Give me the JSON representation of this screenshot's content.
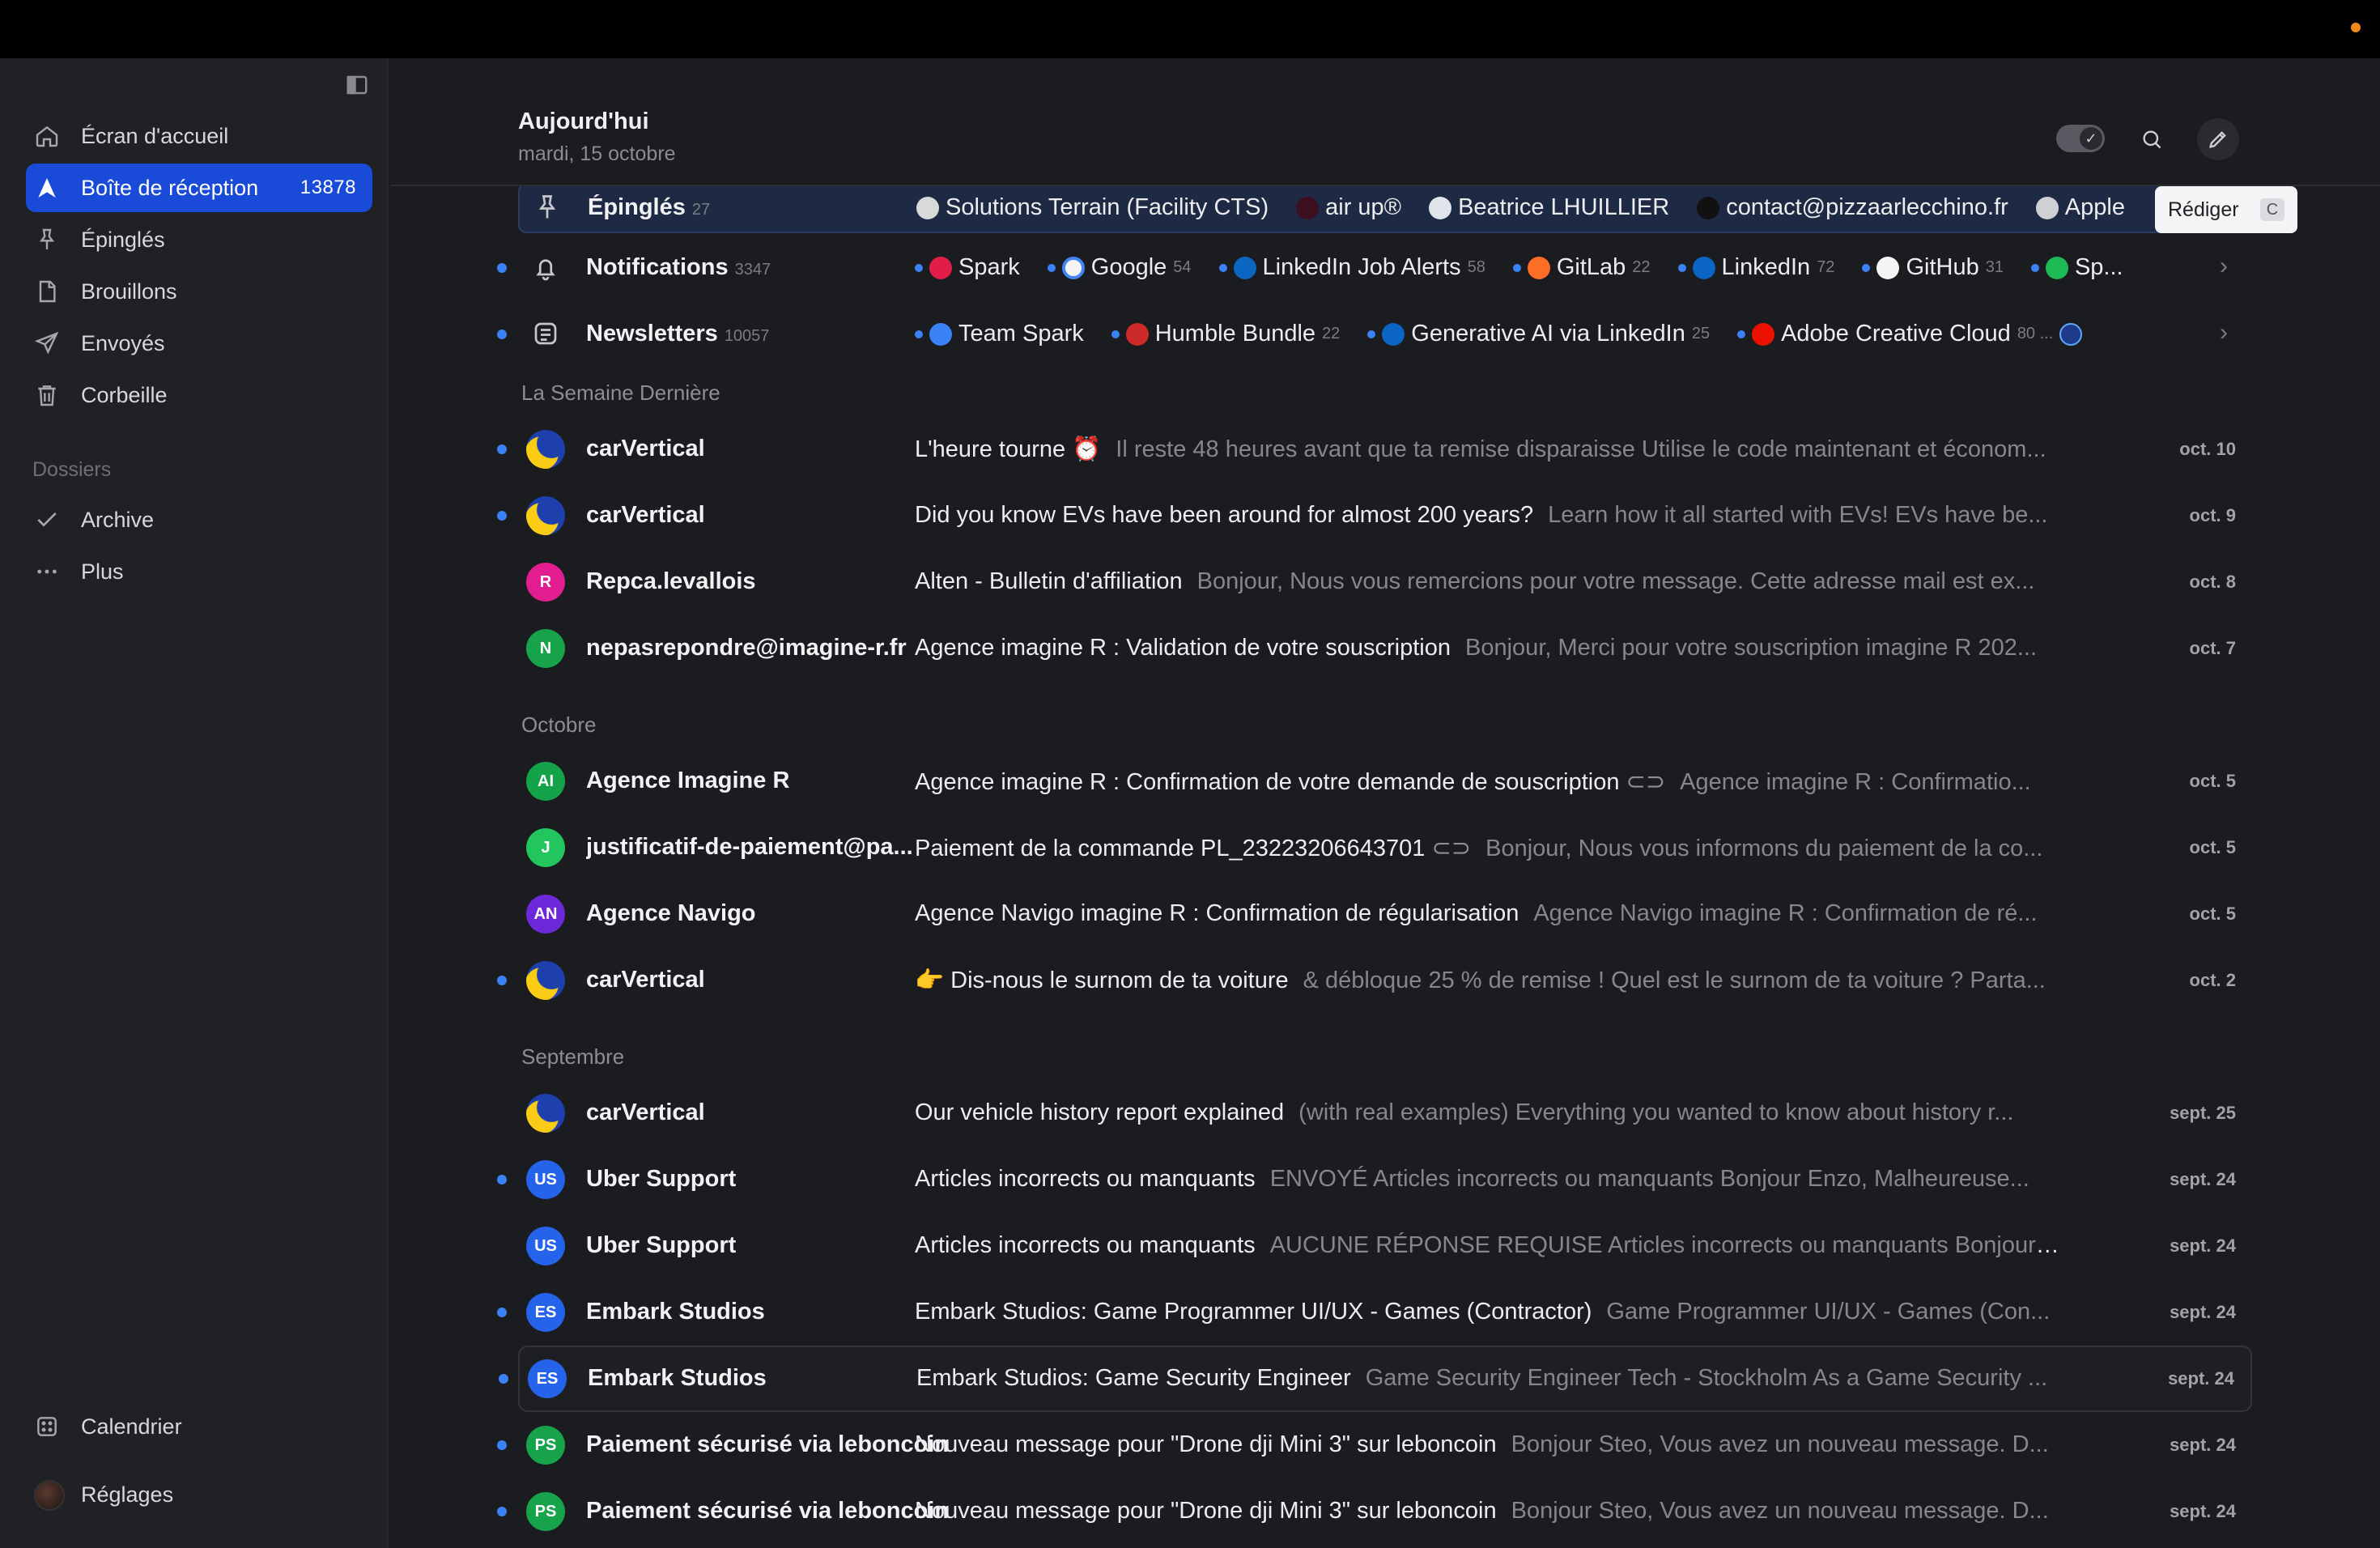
{
  "sidebar": {
    "nav": [
      {
        "label": "Écran d'accueil",
        "icon": "home-icon"
      },
      {
        "label": "Boîte de réception",
        "icon": "inbox-icon",
        "count": "13878"
      },
      {
        "label": "Épinglés",
        "icon": "pin-icon"
      },
      {
        "label": "Brouillons",
        "icon": "draft-icon"
      },
      {
        "label": "Envoyés",
        "icon": "send-icon"
      },
      {
        "label": "Corbeille",
        "icon": "trash-icon"
      }
    ],
    "folders_label": "Dossiers",
    "folders": [
      {
        "label": "Archive",
        "icon": "check-icon"
      },
      {
        "label": "Plus",
        "icon": "more-icon"
      }
    ],
    "bottom": [
      {
        "label": "Calendrier",
        "icon": "calendar-icon"
      },
      {
        "label": "Réglages",
        "icon": "avatar"
      }
    ]
  },
  "header": {
    "title": "Aujourd'hui",
    "date": "mardi, 15 octobre",
    "tooltip": "Rédiger",
    "tooltip_key": "C"
  },
  "categories": [
    {
      "name": "Épinglés",
      "count": "27",
      "icon": "pin-icon",
      "senders": [
        {
          "name": "Solutions Terrain (Facility CTS)",
          "count": ""
        },
        {
          "name": "air up®",
          "count": ""
        },
        {
          "name": "Beatrice LHUILLIER",
          "count": ""
        },
        {
          "name": "contact@pizzaarlecchino.fr",
          "count": ""
        },
        {
          "name": "Apple",
          "count": ""
        }
      ]
    },
    {
      "name": "Notifications",
      "count": "3347",
      "icon": "bell-icon",
      "senders": [
        {
          "name": "Spark",
          "count": ""
        },
        {
          "name": "Google",
          "count": "54"
        },
        {
          "name": "LinkedIn Job Alerts",
          "count": "58"
        },
        {
          "name": "GitLab",
          "count": "22"
        },
        {
          "name": "LinkedIn",
          "count": "72"
        },
        {
          "name": "GitHub",
          "count": "31"
        },
        {
          "name": "Sp...",
          "count": ""
        }
      ]
    },
    {
      "name": "Newsletters",
      "count": "10057",
      "icon": "newspaper-icon",
      "senders": [
        {
          "name": "Team Spark",
          "count": ""
        },
        {
          "name": "Humble Bundle",
          "count": "22"
        },
        {
          "name": "Generative AI via LinkedIn",
          "count": "25"
        },
        {
          "name": "Adobe Creative Cloud",
          "count": "80 ..."
        }
      ]
    }
  ],
  "groups": [
    {
      "label": "La Semaine Dernière",
      "emails": [
        {
          "sender": "carVertical",
          "subject": "L'heure tourne ⏰",
          "preview": "Il reste 48 heures avant que ta remise disparaisse Utilise le code maintenant et économ...",
          "date": "oct. 10",
          "unread": true,
          "avatar": "carvertical"
        },
        {
          "sender": "carVertical",
          "subject": "Did you know EVs have been around for almost 200 years?",
          "preview": "Learn how it all started with EVs! EVs have be...",
          "date": "oct. 9",
          "unread": true,
          "avatar": "carvertical"
        },
        {
          "sender": "Repca.levallois",
          "subject": "Alten - Bulletin d'affiliation",
          "preview": "Bonjour, Nous vous remercions pour votre message. Cette adresse mail est ex...",
          "date": "oct. 8",
          "unread": false,
          "avatar": "R"
        },
        {
          "sender": "nepasrepondre@imagine-r.fr",
          "subject": "Agence imagine R : Validation de votre souscription",
          "preview": "Bonjour, Merci pour votre souscription imagine R 202...",
          "date": "oct. 7",
          "unread": false,
          "avatar": "N"
        }
      ]
    },
    {
      "label": "Octobre",
      "emails": [
        {
          "sender": "Agence Imagine R",
          "subject": "Agence imagine R : Confirmation de votre demande de souscription",
          "preview": "Agence imagine R : Confirmatio...",
          "date": "oct. 5",
          "unread": false,
          "avatar": "AI",
          "attachment": true
        },
        {
          "sender": "justificatif-de-paiement@pa...",
          "subject": "Paiement de la commande PL_23223206643701",
          "preview": "Bonjour, Nous vous informons du paiement de la co...",
          "date": "oct. 5",
          "unread": false,
          "avatar": "J",
          "attachment": true
        },
        {
          "sender": "Agence Navigo",
          "subject": "Agence Navigo imagine R : Confirmation de régularisation",
          "preview": "Agence Navigo imagine R : Confirmation de ré...",
          "date": "oct. 5",
          "unread": false,
          "avatar": "AN"
        },
        {
          "sender": "carVertical",
          "subject": "👉 Dis-nous le surnom de ta voiture",
          "preview": "& débloque 25 % de remise ! Quel est le surnom de ta voiture ? Parta...",
          "date": "oct. 2",
          "unread": true,
          "avatar": "carvertical"
        }
      ]
    },
    {
      "label": "Septembre",
      "emails": [
        {
          "sender": "carVertical",
          "subject": "Our vehicle history report explained",
          "preview": "(with real examples) Everything you wanted to know about history r...",
          "date": "sept. 25",
          "unread": false,
          "avatar": "carvertical"
        },
        {
          "sender": "Uber Support",
          "subject": "Articles incorrects ou manquants",
          "preview": "ENVOYÉ Articles incorrects ou manquants Bonjour Enzo, Malheureuse...",
          "date": "sept. 24",
          "unread": true,
          "avatar": "US"
        },
        {
          "sender": "Uber Support",
          "subject": "Articles incorrects ou manquants",
          "preview": "AUCUNE RÉPONSE REQUISE Articles incorrects ou manquants Bonjour ...",
          "date": "sept. 24",
          "unread": false,
          "avatar": "US"
        },
        {
          "sender": "Embark Studios",
          "subject": "Embark Studios: Game Programmer UI/UX - Games (Contractor)",
          "preview": "Game Programmer UI/UX - Games (Con...",
          "date": "sept. 24",
          "unread": true,
          "avatar": "ES"
        },
        {
          "sender": "Embark Studios",
          "subject": "Embark Studios: Game Security Engineer",
          "preview": "Game Security Engineer Tech - Stockholm As a Game Security ...",
          "date": "sept. 24",
          "unread": true,
          "avatar": "ES",
          "hovered": true
        },
        {
          "sender": "Paiement sécurisé via leboncoin",
          "subject": "Nouveau message pour \"Drone dji Mini 3\" sur leboncoin",
          "preview": "Bonjour Steo, Vous avez un nouveau message. D...",
          "date": "sept. 24",
          "unread": true,
          "avatar": "PS"
        },
        {
          "sender": "Paiement sécurisé via leboncoin",
          "subject": "Nouveau message pour \"Drone dji Mini 3\" sur leboncoin",
          "preview": "Bonjour Steo, Vous avez un nouveau message. D...",
          "date": "sept. 24",
          "unread": true,
          "avatar": "PS"
        }
      ]
    }
  ],
  "colors": {
    "accent": "#1a4bd8",
    "unread_dot": "#3b82f6",
    "avatar_R": "#e11d8f",
    "avatar_N": "#16a34a",
    "avatar_AI": "#15a34a",
    "avatar_J": "#22c55e",
    "avatar_AN": "#6d28d9",
    "avatar_US": "#2563eb",
    "avatar_ES": "#2563eb",
    "avatar_PS": "#16a34a"
  }
}
